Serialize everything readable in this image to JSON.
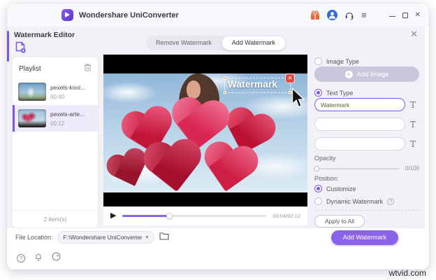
{
  "titlebar": {
    "app_title": "Wondershare UniConverter"
  },
  "editor": {
    "title": "Watermark Editor",
    "close_glyph": "✕",
    "tabs": [
      {
        "label": "Remove Watermark",
        "active": false
      },
      {
        "label": "Add Watermark",
        "active": true
      }
    ]
  },
  "playlist": {
    "title": "Playlist",
    "items": [
      {
        "name": "pexels-kool...",
        "duration": "00:40",
        "selected": false
      },
      {
        "name": "pexels-arte...",
        "duration": "00:12",
        "selected": true
      }
    ],
    "footer": "2 item(s)"
  },
  "player": {
    "watermark_overlay_text": "Watermark",
    "delete_glyph": "✕",
    "play_glyph": "▶",
    "time_display": "00:04/00:12",
    "progress_percent": 33
  },
  "settings": {
    "image_type_label": "Image Type",
    "image_type_selected": false,
    "add_image_label": "Add Image",
    "add_image_plus_glyph": "+",
    "text_type_label": "Text Type",
    "text_type_selected": true,
    "text_inputs": [
      {
        "value": "Watermark",
        "placeholder": ""
      },
      {
        "value": "",
        "placeholder": ""
      },
      {
        "value": "",
        "placeholder": ""
      }
    ],
    "font_icon_glyph": "T",
    "opacity_label": "Opacity",
    "opacity_value": "0/100",
    "opacity_percent": 0,
    "position_label": "Position:",
    "position_options": [
      {
        "label": "Customize",
        "selected": true
      },
      {
        "label": "Dynamic Watermark",
        "selected": false
      }
    ],
    "dynamic_help_glyph": "?",
    "apply_all_label": "Apply to All"
  },
  "footer": {
    "file_location_label": "File Location:",
    "file_location_value": "F:\\Wondershare UniConverter",
    "caret_glyph": "▾",
    "add_watermark_label": "Add Watermark"
  },
  "page": {
    "site_watermark": "wtvid.com"
  },
  "colors": {
    "accent": "#7c57e3",
    "accent_button": "#8a63e8",
    "panel_bg": "#f1f1f7",
    "selected_item_bg": "#efeafa",
    "delete_badge": "#e8493c",
    "avatar_blue": "#2f6ae0",
    "gift_orange": "#e8663c"
  }
}
